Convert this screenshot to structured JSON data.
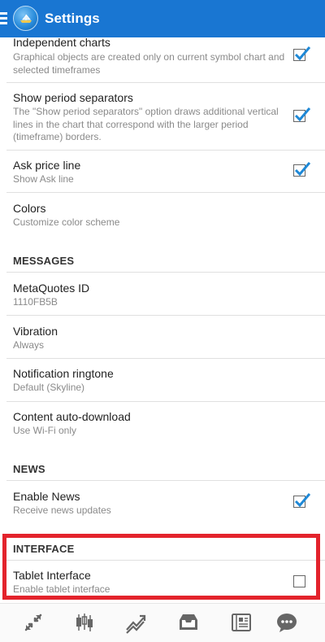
{
  "appbar": {
    "title": "Settings",
    "menu_icon": "hamburger-icon",
    "logo_icon": "metatrader-logo-icon"
  },
  "settings": {
    "independent_charts": {
      "title": "Independent charts",
      "subtitle": "Graphical objects are created only on current symbol chart and selected timeframes",
      "checked": true
    },
    "show_period_separators": {
      "title": "Show period separators",
      "subtitle": "The \"Show period separators\" option draws additional vertical lines in the chart that correspond with the larger period (timeframe) borders.",
      "checked": true
    },
    "ask_price_line": {
      "title": "Ask price line",
      "subtitle": "Show Ask line",
      "checked": true
    },
    "colors": {
      "title": "Colors",
      "subtitle": "Customize color scheme"
    }
  },
  "messages": {
    "header": "MESSAGES",
    "metaquotes_id": {
      "title": "MetaQuotes ID",
      "subtitle": "1110FB5B"
    },
    "vibration": {
      "title": "Vibration",
      "subtitle": "Always"
    },
    "ringtone": {
      "title": "Notification ringtone",
      "subtitle": "Default (Skyline)"
    },
    "auto_download": {
      "title": "Content auto-download",
      "subtitle": "Use Wi-Fi only"
    }
  },
  "news": {
    "header": "NEWS",
    "enable_news": {
      "title": "Enable News",
      "subtitle": "Receive news updates",
      "checked": true
    }
  },
  "interface": {
    "header": "INTERFACE",
    "tablet_interface": {
      "title": "Tablet Interface",
      "subtitle": "Enable tablet interface",
      "checked": false
    }
  },
  "bottom_nav": [
    {
      "icon": "quotes-icon"
    },
    {
      "icon": "chart-icon"
    },
    {
      "icon": "trade-icon"
    },
    {
      "icon": "history-inbox-icon"
    },
    {
      "icon": "news-icon"
    },
    {
      "icon": "chat-icon"
    }
  ],
  "colors": {
    "appbar": "#1976d2",
    "checkmark": "#1e88d6",
    "highlight": "#e3232c"
  }
}
